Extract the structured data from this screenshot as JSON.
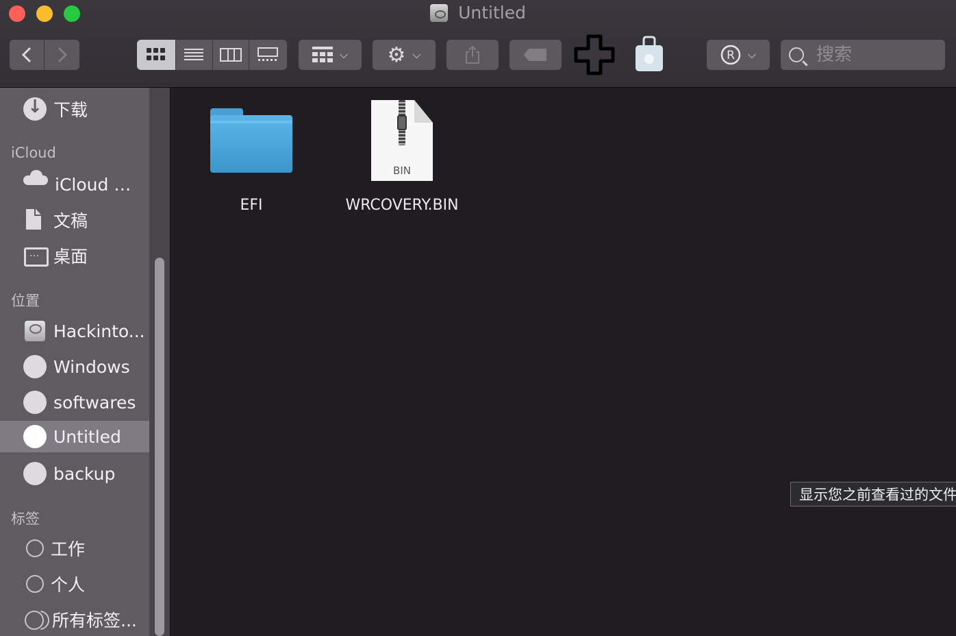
{
  "window": {
    "title": "Untitled",
    "traffic_lights": {
      "close": "#fe5f57",
      "minimize": "#febc2e",
      "zoom": "#28c840"
    }
  },
  "toolbar": {
    "back_icon": "chevron-left-icon",
    "forward_icon": "chevron-right-icon",
    "view_modes": [
      "icon-view-icon",
      "list-view-icon",
      "column-view-icon",
      "gallery-view-icon"
    ],
    "active_view": "icon",
    "group_icon": "group-by-icon",
    "action_icon": "gear-icon",
    "share_icon": "share-icon",
    "tag_icon": "tag-icon",
    "extra_icons": [
      "medical-cross-icon",
      "shopping-bag-icon",
      "registered-mark-icon"
    ],
    "search_placeholder": "搜索"
  },
  "sidebar": {
    "top_items": [
      {
        "label": "下载",
        "icon": "download-icon"
      }
    ],
    "sections": [
      {
        "header": "iCloud",
        "items": [
          {
            "label": "iCloud …",
            "icon": "cloud-icon"
          },
          {
            "label": "文稿",
            "icon": "document-icon"
          },
          {
            "label": "桌面",
            "icon": "desktop-icon"
          }
        ]
      },
      {
        "header": "位置",
        "items": [
          {
            "label": "Hackinto...",
            "icon": "hard-drive-icon"
          },
          {
            "label": "Windows",
            "icon": "disk-icon"
          },
          {
            "label": "softwares",
            "icon": "disk-icon"
          },
          {
            "label": "Untitled",
            "icon": "disk-icon",
            "selected": true
          },
          {
            "label": "backup",
            "icon": "disk-icon"
          }
        ]
      },
      {
        "header": "标签",
        "items": [
          {
            "label": "工作",
            "icon": "tag-circle-icon"
          },
          {
            "label": "个人",
            "icon": "tag-circle-icon"
          },
          {
            "label": "所有标签...",
            "icon": "all-tags-icon"
          }
        ]
      }
    ]
  },
  "files": [
    {
      "name": "EFI",
      "kind": "folder",
      "icon": "folder-icon"
    },
    {
      "name": "WRCOVERY.BIN",
      "kind": "archive",
      "icon": "zip-file-icon",
      "ext_badge": "BIN"
    }
  ],
  "tooltip": {
    "text": "显示您之前查看过的文件"
  },
  "colors": {
    "content_bg": "#1f1d22",
    "sidebar_bg": "#5e5c61",
    "sidebar_selected": "#7e7c82",
    "toolbar_button": "#5b595e",
    "folder_blue": "#4aa9de"
  }
}
